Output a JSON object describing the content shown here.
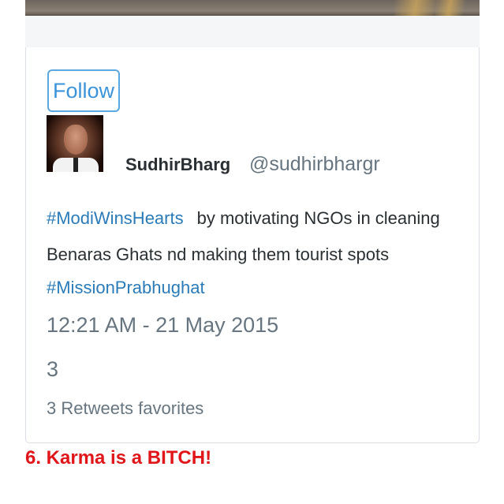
{
  "tweet": {
    "follow_label": "Follow",
    "author_name": "SudhirBharg",
    "author_handle": "@sudhirbhargr",
    "line1_hashtag": "#ModiWinsHearts",
    "line1_text": "by motivating NGOs in cleaning",
    "line2_text": "Benaras Ghats nd making them tourist spots",
    "line3_hashtag": "#MissionPrabhughat",
    "timestamp": "12:21 AM - 21 May 2015",
    "count": "3",
    "engagement": "3 Retweets favorites"
  },
  "caption": "6. Karma is a BITCH!",
  "colors": {
    "link": "#2b7bb9",
    "follow_border": "#5aa7e1",
    "caption": "#e0161a",
    "muted": "#66757f"
  },
  "icons": {
    "avatar": "profile-photo"
  }
}
